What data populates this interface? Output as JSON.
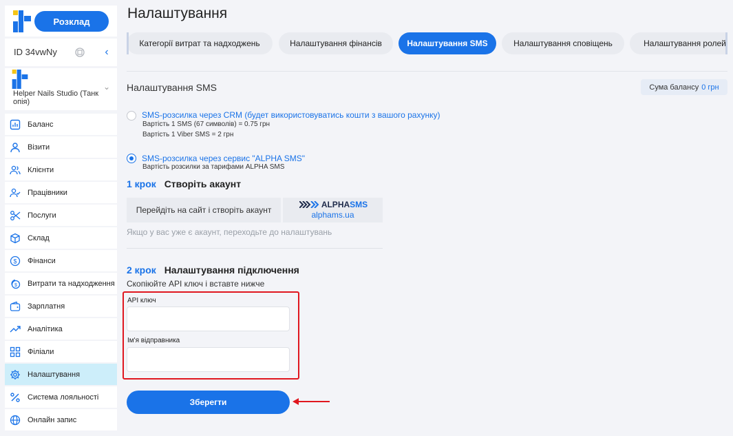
{
  "sidebar": {
    "schedule_button": "Розклад",
    "id_text": "ID 34vwNy",
    "studio_name": "Helper Nails Studio (Танк опія)",
    "items": [
      {
        "label": "Баланс",
        "icon": "chart-icon"
      },
      {
        "label": "Візити",
        "icon": "user-icon"
      },
      {
        "label": "Клієнти",
        "icon": "users-icon"
      },
      {
        "label": "Працівники",
        "icon": "user-check-icon"
      },
      {
        "label": "Послуги",
        "icon": "scissors-icon"
      },
      {
        "label": "Склад",
        "icon": "box-icon"
      },
      {
        "label": "Фінанси",
        "icon": "dollar-icon"
      },
      {
        "label": "Витрати та надходження",
        "icon": "coins-icon"
      },
      {
        "label": "Зарплатня",
        "icon": "wallet-icon"
      },
      {
        "label": "Аналітика",
        "icon": "trend-icon"
      },
      {
        "label": "Філіали",
        "icon": "grid-icon"
      },
      {
        "label": "Налаштування",
        "icon": "gear-icon",
        "active": true
      },
      {
        "label": "Система лояльності",
        "icon": "percent-icon"
      },
      {
        "label": "Онлайн запис",
        "icon": "globe-icon"
      }
    ]
  },
  "page_title": "Налаштування",
  "tabs": [
    {
      "label": "Категорії витрат та надходжень"
    },
    {
      "label": "Налаштування фінансів"
    },
    {
      "label": "Налаштування SMS",
      "active": true
    },
    {
      "label": "Налаштування сповіщень"
    },
    {
      "label": "Налаштування ролей"
    }
  ],
  "sms": {
    "title": "Налаштування SMS",
    "balance_label": "Сума балансу",
    "balance_value": "0 грн",
    "option_crm": {
      "label": "SMS-розсилка через CRM (будет використовуватись кошти з вашого рахунку)",
      "line1": "Вартість 1 SMS (67 символів) = 0.75 грн",
      "line2": "Вартість 1 Viber SMS = 2 грн",
      "selected": false
    },
    "option_alpha": {
      "label": "SMS-розсилка через сервис \"ALPHA SMS\"",
      "line1": "Вартість розсилки за тарифами ALPHA SMS",
      "selected": true
    },
    "step1": {
      "num": "1 крок",
      "title": "Створіть акаунт",
      "site_button": "Перейдіть на сайт і створіть акаунт",
      "alpha_logo_main": "ALPHA",
      "alpha_logo_sms": "SMS",
      "alpha_url": "alphams.ua",
      "hint": "Якщо у вас уже є акаунт, переходьте до налаштувань"
    },
    "step2": {
      "num": "2 крок",
      "title": "Налаштування підключення",
      "subtitle": "Скопіюйте API ключ і вставте нижче",
      "api_label": "API ключ",
      "api_value": "",
      "sender_label": "Ім'я відправника",
      "sender_value": ""
    },
    "save_button": "Зберегти"
  },
  "colors": {
    "accent": "#1a73e8",
    "highlight": "#e0161e",
    "active_menu": "#cdeefa"
  }
}
